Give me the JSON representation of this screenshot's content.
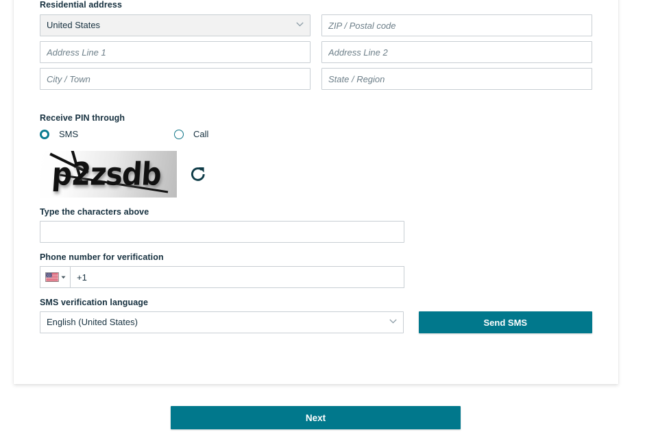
{
  "card": {
    "address": {
      "label": "Residential address",
      "country_value": "United States",
      "zip_placeholder": "ZIP / Postal code",
      "line1_placeholder": "Address Line 1",
      "line2_placeholder": "Address Line 2",
      "city_placeholder": "City / Town",
      "state_placeholder": "State / Region"
    },
    "pin": {
      "label": "Receive PIN through",
      "options": [
        {
          "label": "SMS",
          "selected": true
        },
        {
          "label": "Call",
          "selected": false
        }
      ]
    },
    "captcha": {
      "text": "p2zsdb",
      "refresh_icon": "refresh-icon",
      "answer_label": "Type the characters above",
      "answer_value": ""
    },
    "phone": {
      "label": "Phone number for verification",
      "country_flag": "us-flag-icon",
      "value": "+1"
    },
    "language": {
      "label": "SMS verification language",
      "value": "English (United States)"
    },
    "send_sms_label": "Send SMS"
  },
  "footer": {
    "next_label": "Next"
  },
  "colors": {
    "accent": "#01788c",
    "label": "#16303f",
    "border": "#c8ced3",
    "select_bg": "#f2f2f2"
  }
}
